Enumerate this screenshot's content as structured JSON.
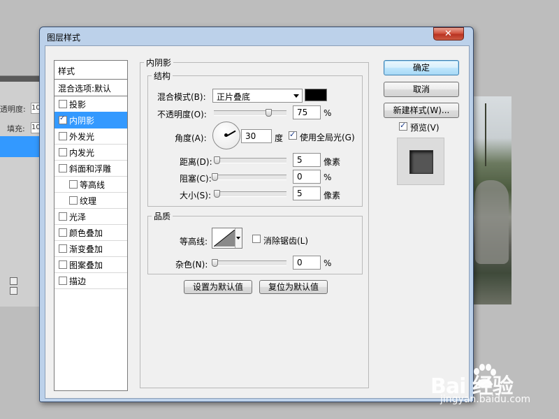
{
  "dialog": {
    "title": "图层样式",
    "close_symbol": "✕"
  },
  "styles_list": {
    "header": "样式",
    "blend_options": "混合选项:默认",
    "items": [
      {
        "label": "投影",
        "checked": false,
        "selected": false,
        "sub": false
      },
      {
        "label": "内阴影",
        "checked": true,
        "selected": true,
        "sub": false
      },
      {
        "label": "外发光",
        "checked": false,
        "selected": false,
        "sub": false
      },
      {
        "label": "内发光",
        "checked": false,
        "selected": false,
        "sub": false
      },
      {
        "label": "斜面和浮雕",
        "checked": false,
        "selected": false,
        "sub": false
      },
      {
        "label": "等高线",
        "checked": false,
        "selected": false,
        "sub": true
      },
      {
        "label": "纹理",
        "checked": false,
        "selected": false,
        "sub": true
      },
      {
        "label": "光泽",
        "checked": false,
        "selected": false,
        "sub": false
      },
      {
        "label": "颜色叠加",
        "checked": false,
        "selected": false,
        "sub": false
      },
      {
        "label": "渐变叠加",
        "checked": false,
        "selected": false,
        "sub": false
      },
      {
        "label": "图案叠加",
        "checked": false,
        "selected": false,
        "sub": false
      },
      {
        "label": "描边",
        "checked": false,
        "selected": false,
        "sub": false
      }
    ]
  },
  "inner_shadow": {
    "section_title": "内阴影",
    "structure": {
      "title": "结构",
      "blend_mode_label": "混合模式(B):",
      "blend_mode_value": "正片叠底",
      "shadow_color": "#000000",
      "opacity_label": "不透明度(O):",
      "opacity_value": "75",
      "opacity_unit": "%",
      "opacity_level": 0.75,
      "angle_label": "角度(A):",
      "angle_value": "30",
      "angle_unit": "度",
      "global_light_label": "使用全局光(G)",
      "global_light_checked": true,
      "distance_label": "距离(D):",
      "distance_value": "5",
      "distance_unit": "像素",
      "choke_label": "阻塞(C):",
      "choke_value": "0",
      "choke_unit": "%",
      "size_label": "大小(S):",
      "size_value": "5",
      "size_unit": "像素"
    },
    "quality": {
      "title": "品质",
      "contour_label": "等高线:",
      "antialias_label": "消除锯齿(L)",
      "antialias_checked": false,
      "noise_label": "杂色(N):",
      "noise_value": "0",
      "noise_unit": "%"
    },
    "set_default_label": "设置为默认值",
    "reset_default_label": "复位为默认值"
  },
  "actions": {
    "ok_label": "确定",
    "cancel_label": "取消",
    "new_style_label": "新建样式(W)...",
    "preview_label": "预览(V)",
    "preview_checked": true
  },
  "background_app": {
    "opacity_label": "透明度:",
    "opacity_value": "10",
    "fill_label": "填充:",
    "fill_value": "10"
  },
  "watermark": {
    "brand": "Bai 经验",
    "url": "jingyan.baidu.com"
  }
}
